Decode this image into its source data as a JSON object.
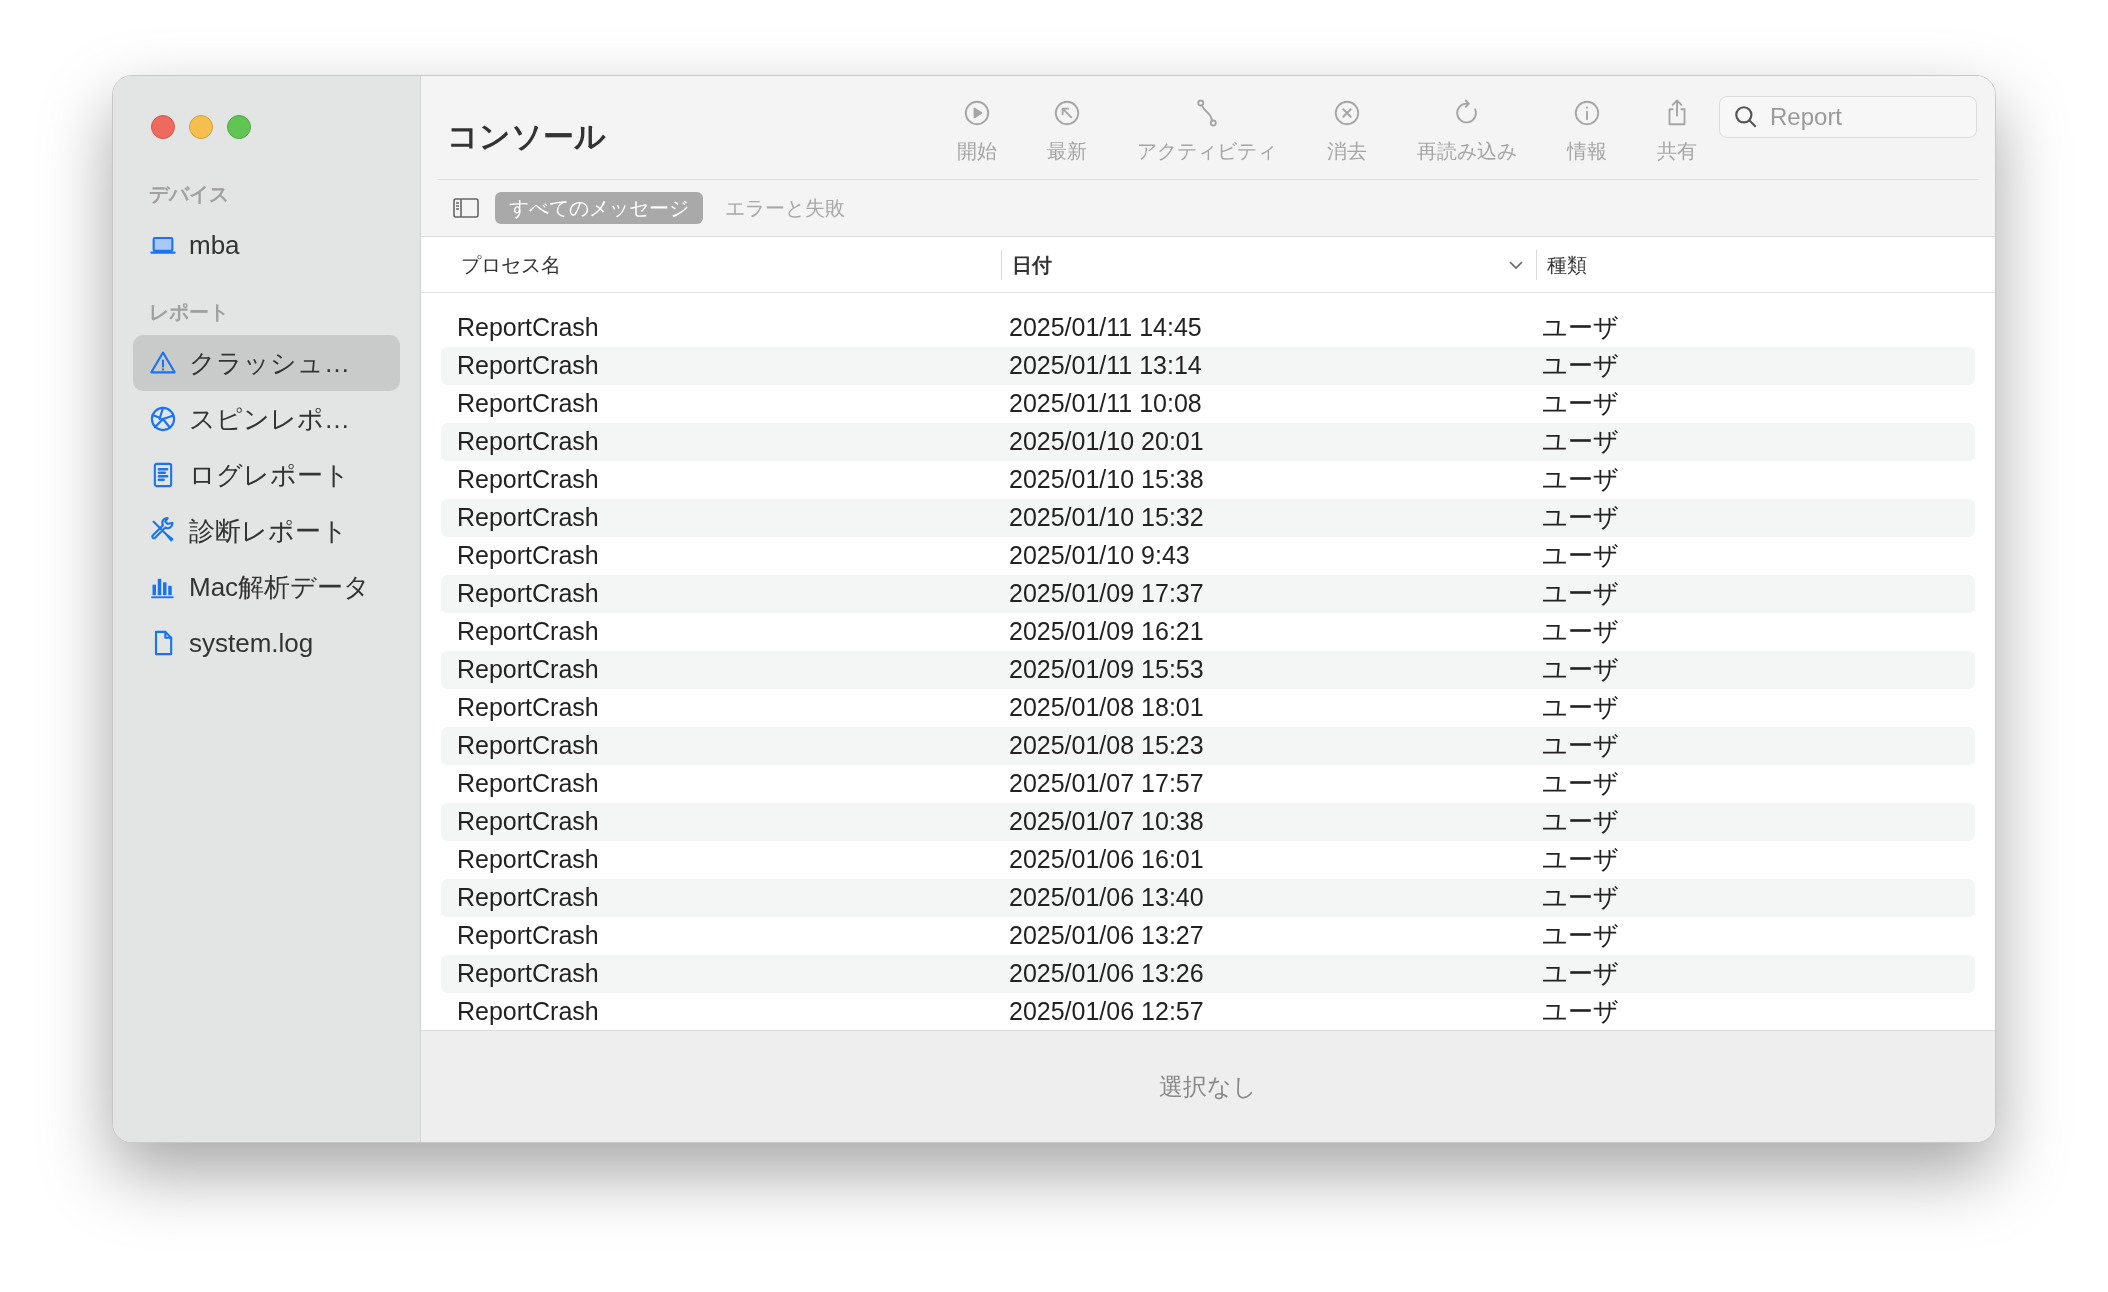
{
  "sidebar": {
    "sections": [
      {
        "title": "デバイス",
        "items": [
          {
            "label": "mba",
            "selected": false
          }
        ]
      },
      {
        "title": "レポート",
        "items": [
          {
            "label": "クラッシュ…",
            "selected": true
          },
          {
            "label": "スピンレポ…",
            "selected": false
          },
          {
            "label": "ログレポート",
            "selected": false
          },
          {
            "label": "診断レポート",
            "selected": false
          },
          {
            "label": "Mac解析データ",
            "selected": false
          },
          {
            "label": "system.log",
            "selected": false
          }
        ]
      }
    ]
  },
  "window": {
    "title": "コンソール"
  },
  "toolbar": [
    {
      "label": "開始",
      "disabled": true
    },
    {
      "label": "最新",
      "disabled": true
    },
    {
      "label": "アクティビティ",
      "disabled": true
    },
    {
      "label": "消去",
      "disabled": true
    },
    {
      "label": "再読み込み",
      "disabled": true
    },
    {
      "label": "情報",
      "disabled": true
    },
    {
      "label": "共有",
      "disabled": true
    }
  ],
  "search": {
    "placeholder": "Report"
  },
  "filters": [
    {
      "label": "すべてのメッセージ",
      "selected": true
    },
    {
      "label": "エラーと失敗",
      "selected": false
    }
  ],
  "table": {
    "columns": [
      {
        "label": "プロセス名",
        "sorted": false
      },
      {
        "label": "日付",
        "sorted": true
      },
      {
        "label": "種類",
        "sorted": false
      }
    ],
    "rows": [
      [
        "ReportCrash",
        "2025/01/11 14:45",
        "ユーザ"
      ],
      [
        "ReportCrash",
        "2025/01/11 13:14",
        "ユーザ"
      ],
      [
        "ReportCrash",
        "2025/01/11 10:08",
        "ユーザ"
      ],
      [
        "ReportCrash",
        "2025/01/10 20:01",
        "ユーザ"
      ],
      [
        "ReportCrash",
        "2025/01/10 15:38",
        "ユーザ"
      ],
      [
        "ReportCrash",
        "2025/01/10 15:32",
        "ユーザ"
      ],
      [
        "ReportCrash",
        "2025/01/10 9:43",
        "ユーザ"
      ],
      [
        "ReportCrash",
        "2025/01/09 17:37",
        "ユーザ"
      ],
      [
        "ReportCrash",
        "2025/01/09 16:21",
        "ユーザ"
      ],
      [
        "ReportCrash",
        "2025/01/09 15:53",
        "ユーザ"
      ],
      [
        "ReportCrash",
        "2025/01/08 18:01",
        "ユーザ"
      ],
      [
        "ReportCrash",
        "2025/01/08 15:23",
        "ユーザ"
      ],
      [
        "ReportCrash",
        "2025/01/07 17:57",
        "ユーザ"
      ],
      [
        "ReportCrash",
        "2025/01/07 10:38",
        "ユーザ"
      ],
      [
        "ReportCrash",
        "2025/01/06 16:01",
        "ユーザ"
      ],
      [
        "ReportCrash",
        "2025/01/06 13:40",
        "ユーザ"
      ],
      [
        "ReportCrash",
        "2025/01/06 13:27",
        "ユーザ"
      ],
      [
        "ReportCrash",
        "2025/01/06 13:26",
        "ユーザ"
      ],
      [
        "ReportCrash",
        "2025/01/06 12:57",
        "ユーザ"
      ]
    ]
  },
  "detail": {
    "text": "選択なし"
  }
}
